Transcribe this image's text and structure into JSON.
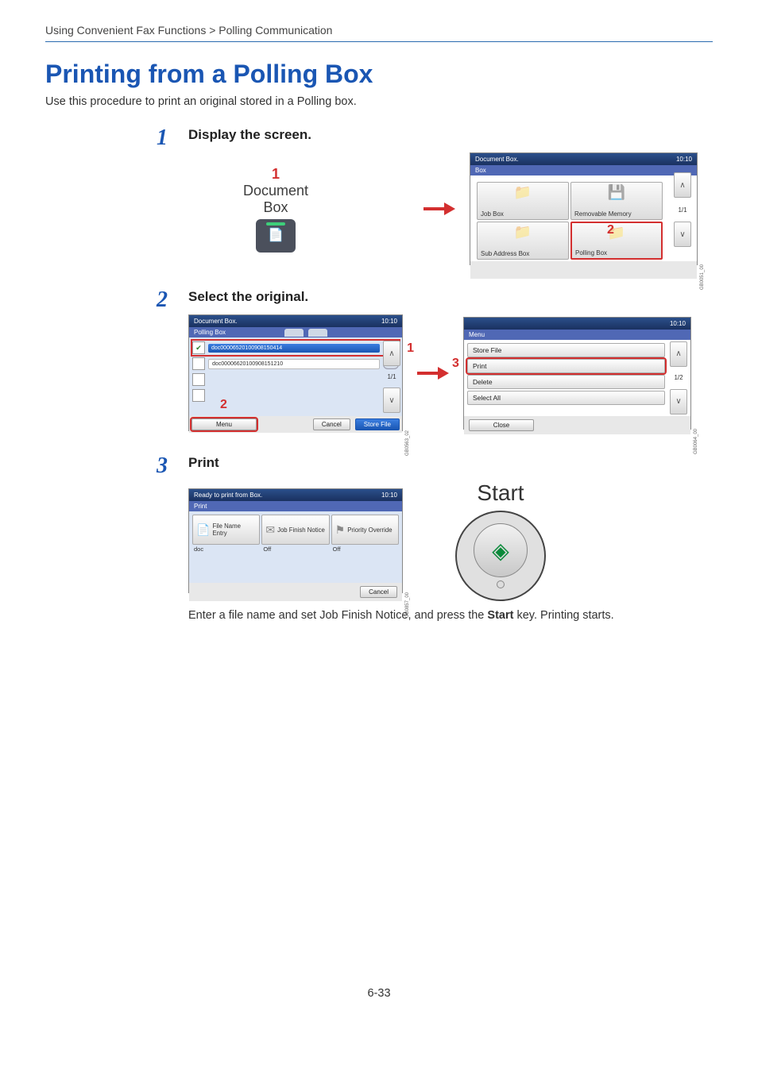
{
  "breadcrumb": "Using Convenient Fax Functions > Polling Communication",
  "title": "Printing from a Polling Box",
  "intro": "Use this procedure to print an original stored in a Polling box.",
  "step1": {
    "num": "1",
    "title": "Display the screen.",
    "icon": {
      "mark": "1",
      "line1": "Document",
      "line2": "Box"
    },
    "panel": {
      "hdr": "Document Box.",
      "time": "10:10",
      "sub": "Box",
      "cards": [
        "Job Box",
        "Removable Memory",
        "Sub Address Box",
        "Polling Box"
      ],
      "mark": "2",
      "page": "1/1",
      "sidelabel": "GB0051_00"
    }
  },
  "step2": {
    "num": "2",
    "title": "Select the original.",
    "panelA": {
      "hdr": "Document Box.",
      "time": "10:10",
      "sub": "Polling Box",
      "rows": [
        "doc00006520100908150414",
        "doc00006620100908151210"
      ],
      "page": "1/1",
      "menu": "Menu",
      "cancel": "Cancel",
      "store": "Store File",
      "mark1": "1",
      "mark2": "2",
      "sidelabel": "GB0563_02"
    },
    "panelB": {
      "time": "10:10",
      "sub": "Menu",
      "items": [
        "Store File",
        "Print",
        "Delete",
        "Select All"
      ],
      "page": "1/2",
      "close": "Close",
      "mark": "3",
      "sidelabel": "GB0064_00"
    }
  },
  "step3": {
    "num": "3",
    "title": "Print",
    "panel": {
      "hdr": "Ready to print from Box.",
      "time": "10:10",
      "sub": "Print",
      "opts": [
        {
          "name": "File Name Entry",
          "val": "doc"
        },
        {
          "name": "Job Finish Notice",
          "val": "Off"
        },
        {
          "name": "Priority Override",
          "val": "Off"
        }
      ],
      "cancel": "Cancel",
      "sidelabel": "GB0857_00"
    },
    "start": "Start",
    "note_pre": "Enter a file name and set Job Finish Notice, and press the ",
    "note_strong": "Start",
    "note_post": " key. Printing starts."
  },
  "pagenum": "6-33"
}
